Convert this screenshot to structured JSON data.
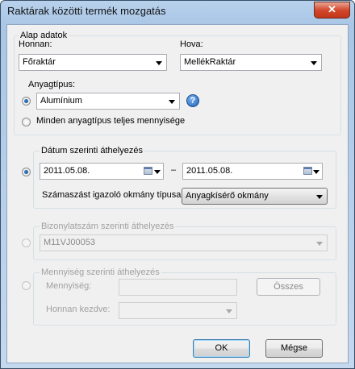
{
  "window": {
    "title": "Raktárak közötti termék mozgatás",
    "close_symbol": "✕"
  },
  "basic": {
    "legend": "Alap adatok",
    "from_label": "Honnan:",
    "from_value": "Főraktár",
    "to_label": "Hova:",
    "to_value": "MellékRaktár",
    "material_label": "Anyagtípus:",
    "material_value": "Alumínium",
    "help_symbol": "?",
    "all_materials_label": "Minden anyagtípus teljes mennyisége"
  },
  "by_date": {
    "legend": "Dátum szerinti áthelyezés",
    "date_from": "2011.05.08.",
    "dash": "–",
    "date_to": "2011.05.08.",
    "doc_type_label": "Számaszást igazoló okmány típusa:",
    "doc_type_value": "Anyagkísérő okmány"
  },
  "by_document": {
    "legend": "Bizonylatszám szerinti áthelyezés",
    "document_value": "M11VJ00053"
  },
  "by_quantity": {
    "legend": "Mennyiség szerinti áthelyezés",
    "quantity_label": "Mennyiség:",
    "quantity_value": "",
    "all_button": "Összes",
    "start_from_label": "Honnan kezdve:",
    "start_from_value": ""
  },
  "footer": {
    "ok_button": "OK",
    "cancel_button": "Mégse"
  }
}
